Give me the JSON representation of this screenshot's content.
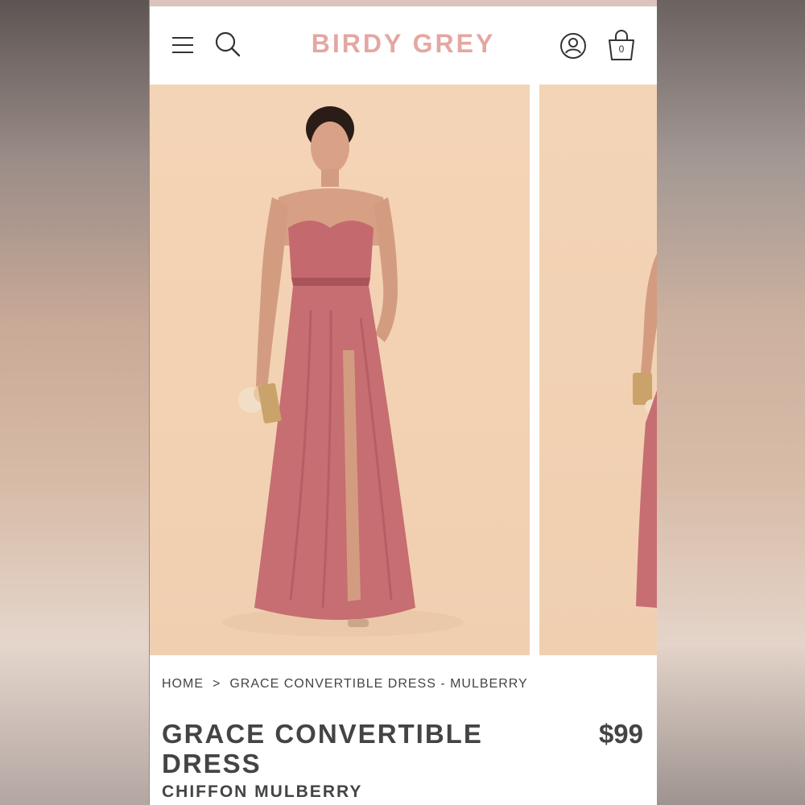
{
  "header": {
    "logo": "BIRDY GREY",
    "cart_count": "0"
  },
  "icons": {
    "menu": "hamburger-menu-icon",
    "search": "search-icon",
    "account": "user-account-icon",
    "bag": "shopping-bag-icon"
  },
  "breadcrumb": {
    "home": "HOME",
    "separator": ">",
    "current": "GRACE CONVERTIBLE DRESS - MULBERRY"
  },
  "product": {
    "title": "GRACE CONVERTIBLE DRESS",
    "price": "$99",
    "subtitle": "CHIFFON MULBERRY"
  },
  "colors": {
    "brand": "#e4a7a2",
    "text": "#444444",
    "dress": "#c46a6f",
    "backdrop": "#f4d4b6"
  }
}
